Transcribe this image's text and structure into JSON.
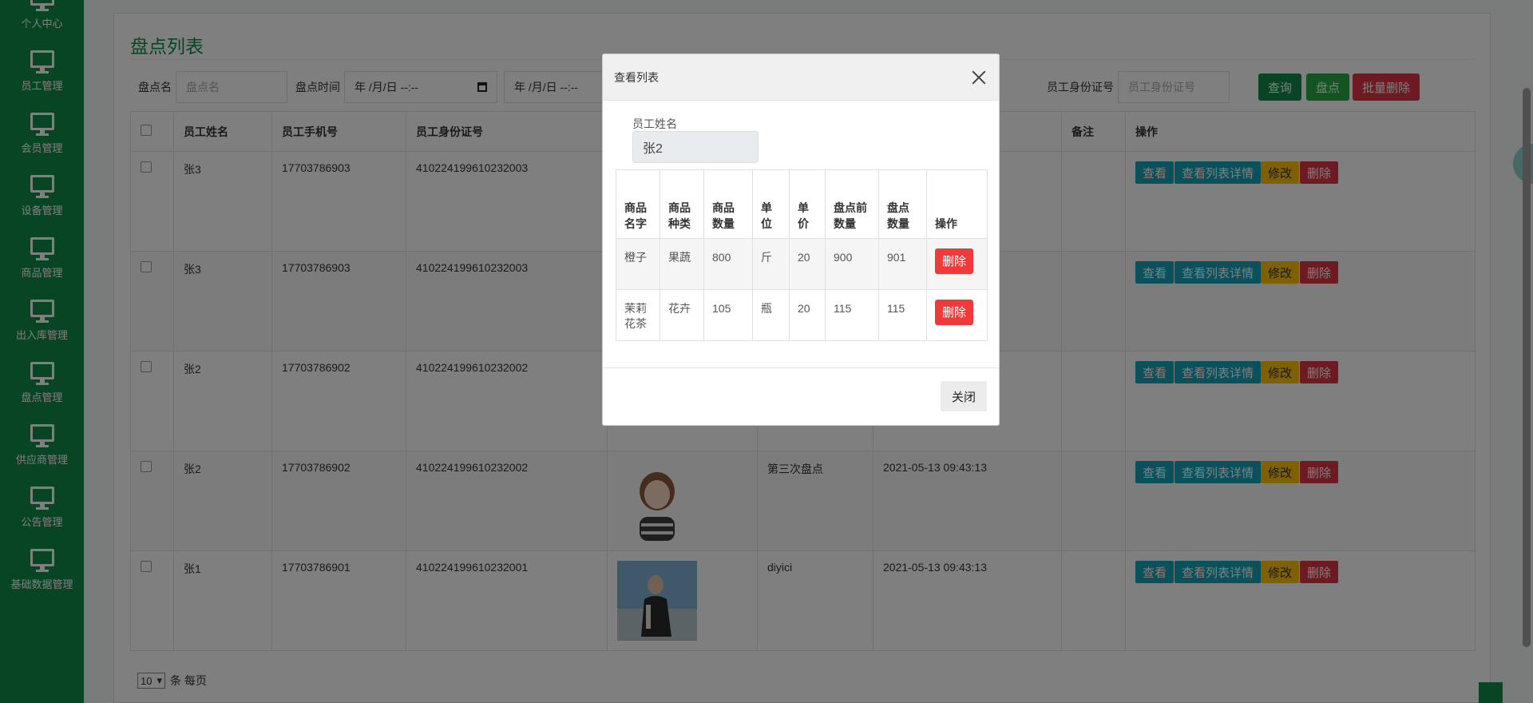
{
  "sidebar": {
    "items": [
      {
        "label": "个人中心"
      },
      {
        "label": "员工管理"
      },
      {
        "label": "会员管理"
      },
      {
        "label": "设备管理"
      },
      {
        "label": "商品管理"
      },
      {
        "label": "出入库管理"
      },
      {
        "label": "盘点管理"
      },
      {
        "label": "供应商管理"
      },
      {
        "label": "公告管理"
      },
      {
        "label": "基础数据管理"
      }
    ]
  },
  "page": {
    "title": "盘点列表",
    "search": {
      "name_label": "盘点名",
      "name_placeholder": "盘点名",
      "time_label": "盘点时间",
      "date_start": "年 /月/日 --:--",
      "date_end": "年 /月/日 --:--",
      "id_label": "员工身份证号",
      "id_placeholder": "员工身份证号",
      "query_btn": "查询",
      "check_btn": "盘点",
      "batch_delete_btn": "批量删除"
    },
    "table": {
      "headers": [
        "员工姓名",
        "员工手机号",
        "员工身份证号",
        "",
        "",
        "",
        "备注",
        "操作"
      ],
      "rows": [
        {
          "name": "张3",
          "phone": "17703786903",
          "id": "410224199610232003",
          "check_name": "",
          "time": ""
        },
        {
          "name": "张3",
          "phone": "17703786903",
          "id": "410224199610232003",
          "check_name": "",
          "time": ""
        },
        {
          "name": "张2",
          "phone": "17703786902",
          "id": "410224199610232002",
          "check_name": "",
          "time": ""
        },
        {
          "name": "张2",
          "phone": "17703786902",
          "id": "410224199610232002",
          "check_name": "第三次盘点",
          "time": "2021-05-13 09:43:13"
        },
        {
          "name": "张1",
          "phone": "17703786901",
          "id": "410224199610232001",
          "check_name": "diyici",
          "time": "2021-05-13 09:43:13"
        }
      ],
      "ops": {
        "view": "查看",
        "detail": "查看列表详情",
        "edit": "修改",
        "remove": "删除"
      }
    },
    "pager": {
      "page_size": "10",
      "suffix": "条 每页"
    }
  },
  "modal": {
    "title": "查看列表",
    "field_label": "员工姓名",
    "field_value": "张2",
    "headers": [
      "商品名字",
      "商品种类",
      "商品数量",
      "单位",
      "单价",
      "盘点前数量",
      "盘点数量",
      "操作"
    ],
    "rows": [
      {
        "name": "橙子",
        "kind": "果蔬",
        "qty": "800",
        "unit": "斤",
        "price": "20",
        "before": "900",
        "after": "901"
      },
      {
        "name": "茉莉花茶",
        "kind": "花卉",
        "qty": "105",
        "unit": "瓶",
        "price": "20",
        "before": "115",
        "after": "115"
      }
    ],
    "delete_btn": "删除",
    "close_btn": "关闭"
  }
}
